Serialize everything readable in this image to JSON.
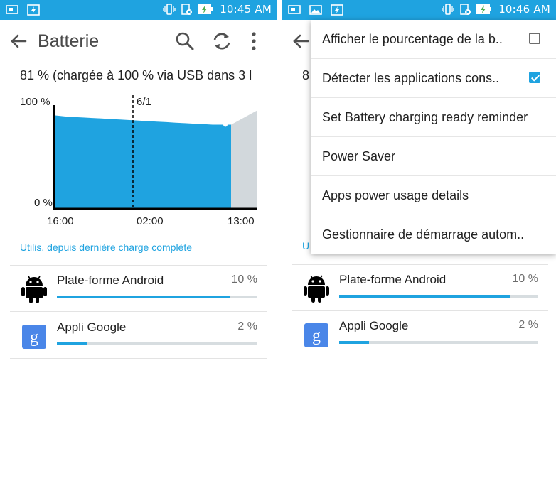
{
  "colors": {
    "accent": "#1fa3e0",
    "chart_fill": "#1fa3e0",
    "chart_projection": "#d2d8dc"
  },
  "left": {
    "status_bar": {
      "time": "10:45 AM",
      "icons": [
        "screenshot-icon",
        "flash-icon",
        "vibrate-icon",
        "sd-card-icon",
        "battery-charging-icon"
      ]
    },
    "app_bar": {
      "title": "Batterie",
      "actions": [
        "search-icon",
        "refresh-icon",
        "overflow-menu-icon"
      ]
    },
    "battery_status": "81 % (chargée à 100 % via USB dans 3 l",
    "chart_data": {
      "type": "area",
      "y_labels": [
        "100 %",
        "0 %"
      ],
      "x_tick_labels": [
        "16:00",
        "02:00",
        "13:00"
      ],
      "date_marker": "6/1",
      "ylim": [
        0,
        100
      ],
      "x": [
        0,
        1,
        2,
        3,
        4,
        5,
        6,
        7,
        8,
        9,
        10,
        11,
        12,
        13,
        14,
        15,
        16,
        17,
        18,
        19
      ],
      "values": [
        90,
        89,
        88.5,
        88,
        87.5,
        87,
        86.5,
        86,
        85.5,
        85,
        84.5,
        84,
        83.5,
        83,
        82.5,
        82,
        81.5,
        81,
        81,
        81
      ],
      "projection_values": [
        81,
        88,
        95
      ]
    },
    "usage_caption": "Utilis. depuis dernière charge complète",
    "apps": [
      {
        "name": "Plate-forme Android",
        "percent": "10 %",
        "fraction": 0.86,
        "icon": "android-robot-icon"
      },
      {
        "name": "Appli Google",
        "percent": "2 %",
        "fraction": 0.15,
        "icon": "google-g-icon"
      }
    ]
  },
  "right": {
    "status_bar": {
      "time": "10:46 AM"
    },
    "battery_status_fragment": "8",
    "usage_caption_fragment": "U",
    "menu": [
      {
        "label": "Afficher le pourcentage de la b..",
        "checkbox": "unchecked"
      },
      {
        "label": "Détecter les applications cons..",
        "checkbox": "checked"
      },
      {
        "label": "Set Battery charging ready reminder"
      },
      {
        "label": "Power Saver"
      },
      {
        "label": "Apps power usage details"
      },
      {
        "label": "Gestionnaire de démarrage autom.."
      }
    ],
    "apps": [
      {
        "name": "Plate-forme Android",
        "percent": "10 %",
        "fraction": 0.86
      },
      {
        "name": "Appli Google",
        "percent": "2 %",
        "fraction": 0.15
      }
    ]
  }
}
